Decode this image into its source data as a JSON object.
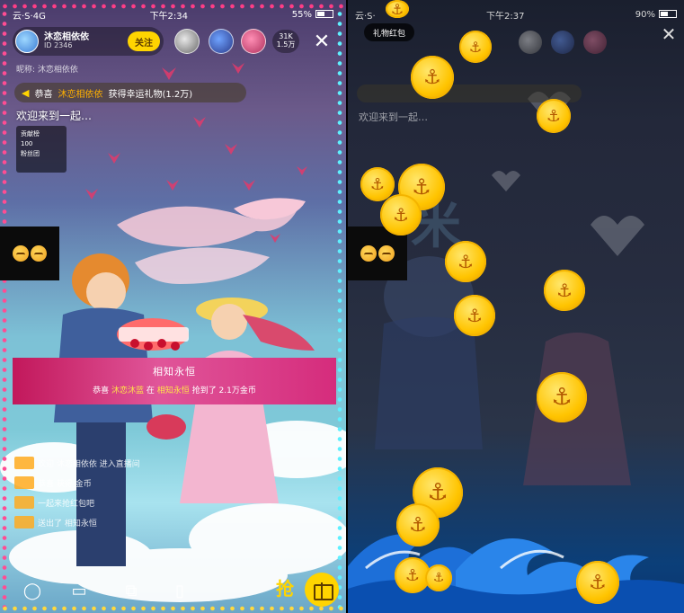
{
  "left": {
    "status": {
      "time": "下午2:34",
      "left_text": "云·S·4G",
      "battery_text": "55%"
    },
    "host": {
      "name": "沐恋相依依",
      "sub": "ID 2346",
      "follow_label": "关注"
    },
    "viewer_count": "31K\n1.5万",
    "close_symbol": "✕",
    "host_id": "昵称: 沐恋相依依",
    "notice": {
      "prefix": "恭喜",
      "highlight": "沐恋相依依",
      "suffix": "获得幸运礼物(1.2万)"
    },
    "welcome": "欢迎来到一起…",
    "stats": [
      "贡献榜",
      "100",
      "粉丝团"
    ],
    "gift_banner": {
      "title": "相知永恒",
      "line_prefix": "恭喜",
      "line_name": "沐恋沐蓝",
      "line_mid": "在",
      "line_gift": "相知永恒",
      "line_suffix": "抢到了 2.1万金币"
    },
    "chat": [
      {
        "text": "欢迎 沐恋相依依 进入直播间"
      },
      {
        "text": "恭喜 获得 金币"
      },
      {
        "text": "一起来抢红包吧"
      },
      {
        "text": "送出了 相知永恒"
      }
    ],
    "bottom": {
      "comment_icon": "◯",
      "video_icon": "▭",
      "share_icon": "⧉",
      "more_icon": "▯",
      "grab_label": "抢"
    }
  },
  "right": {
    "status": {
      "time": "下午2:37",
      "left_text": "云·S·",
      "battery_text": "90%"
    },
    "tag_label": "礼物红包",
    "close_symbol": "✕",
    "welcome": "欢迎来到一起…",
    "coin_symbol": "⚓"
  },
  "colors": {
    "accent_yellow": "#ffd400",
    "pink_banner": "#d52c7c",
    "coin_gold": "#ffc400"
  }
}
